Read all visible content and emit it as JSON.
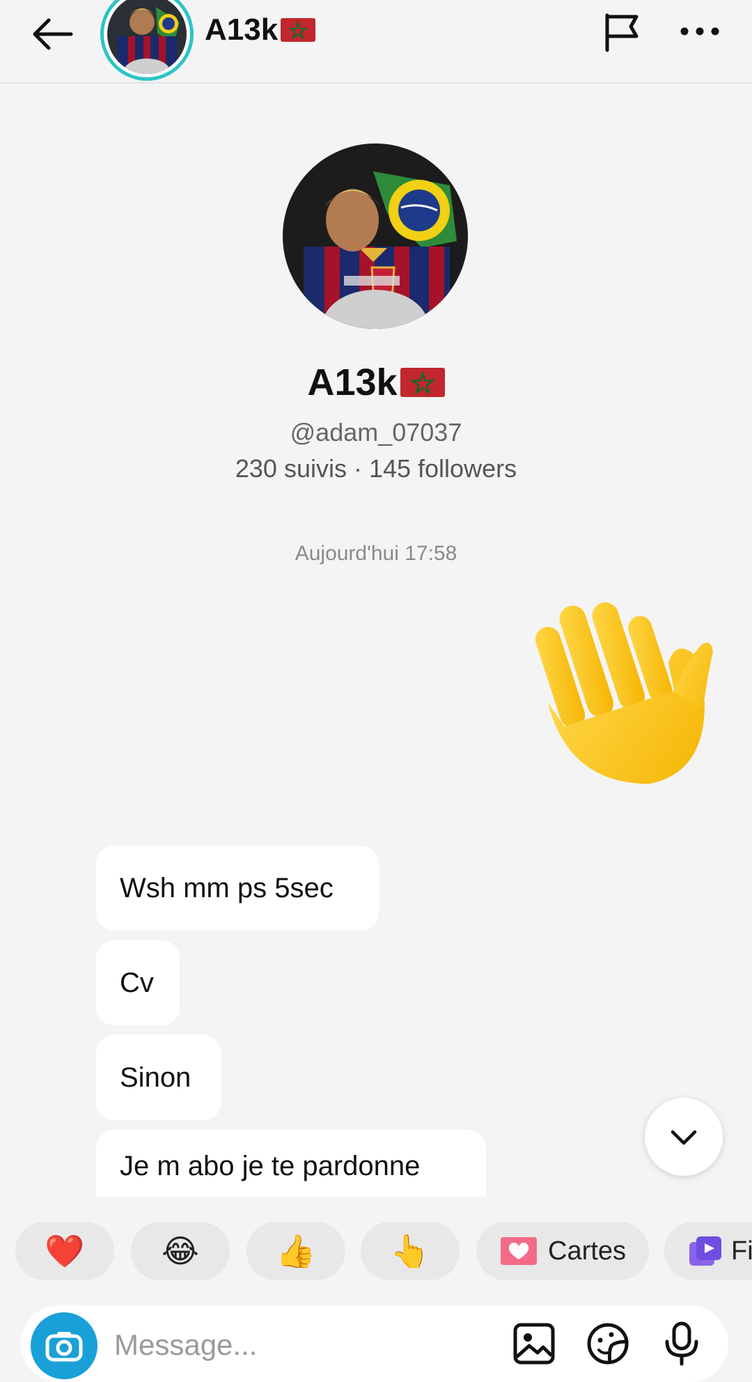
{
  "header": {
    "name": "A13k"
  },
  "profile": {
    "name": "A13k",
    "handle": "@adam_07037",
    "stats": "230 suivis · 145 followers"
  },
  "conversation": {
    "timestamp": "Aujourd'hui 17:58",
    "sent_sticker": "waving-hand",
    "messages": [
      {
        "text": "Wsh mm ps 5sec"
      },
      {
        "text": "Cv"
      },
      {
        "text": "Sinon"
      },
      {
        "text": "Je m abo je te pardonne"
      }
    ]
  },
  "quick_replies": [
    {
      "emoji": "❤️",
      "icon": "red-heart"
    },
    {
      "emoji": "😂",
      "icon": "tears-of-joy"
    },
    {
      "emoji": "👍",
      "icon": "thumbs-up"
    },
    {
      "emoji": "👆",
      "icon": "pointing-up"
    },
    {
      "label": "Cartes",
      "icon": "card-heart-icon"
    },
    {
      "label": "Fi",
      "icon": "video-stack-icon"
    }
  ],
  "composer": {
    "placeholder": "Message..."
  },
  "colors": {
    "background": "#f4f4f4",
    "avatar_ring": "#2ec4c4",
    "camera_button": "#1aa0d8",
    "bubble": "#ffffff"
  }
}
